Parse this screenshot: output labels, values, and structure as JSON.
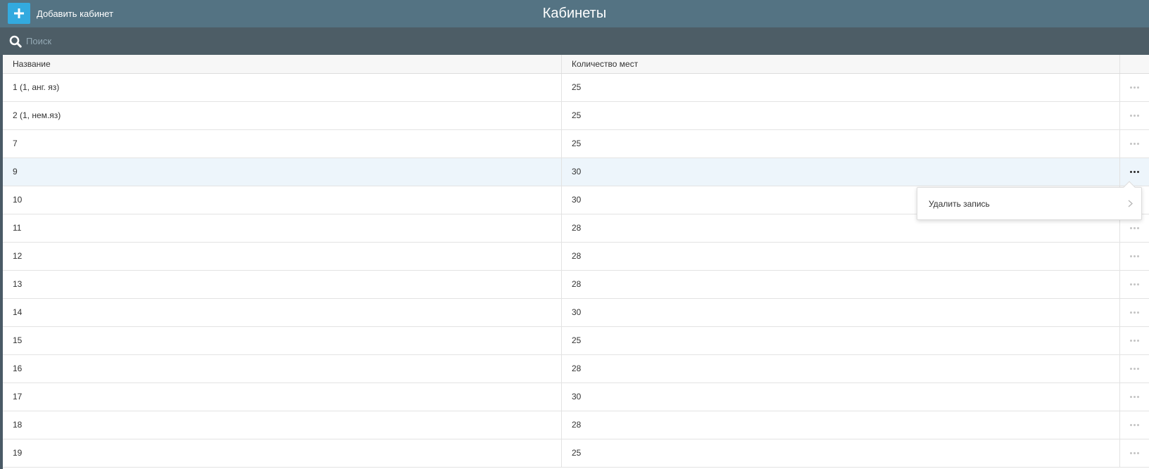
{
  "header": {
    "add_button_label": "Добавить кабинет",
    "title": "Кабинеты",
    "add_icon": "plus-icon"
  },
  "search": {
    "placeholder": "Поиск",
    "value": "",
    "icon": "search-icon"
  },
  "table": {
    "columns": [
      "Название",
      "Количество мест"
    ],
    "rows": [
      {
        "name": "1 (1, анг. яз)",
        "seats": "25"
      },
      {
        "name": "2 (1, нем.яз)",
        "seats": "25"
      },
      {
        "name": "7",
        "seats": "25"
      },
      {
        "name": "9",
        "seats": "30"
      },
      {
        "name": "10",
        "seats": "30"
      },
      {
        "name": "11",
        "seats": "28"
      },
      {
        "name": "12",
        "seats": "28"
      },
      {
        "name": "13",
        "seats": "28"
      },
      {
        "name": "14",
        "seats": "30"
      },
      {
        "name": "15",
        "seats": "25"
      },
      {
        "name": "16",
        "seats": "28"
      },
      {
        "name": "17",
        "seats": "30"
      },
      {
        "name": "18",
        "seats": "28"
      },
      {
        "name": "19",
        "seats": "25"
      }
    ],
    "active_row_index": 3,
    "row_actions_icon": "more-horizontal-icon"
  },
  "context_menu": {
    "items": [
      {
        "label": "Удалить запись"
      }
    ],
    "chevron_icon": "chevron-right-icon"
  },
  "colors": {
    "header_bg": "#547383",
    "search_bg": "#4d5d66",
    "accent": "#33aadf",
    "active_row_bg": "#edf5fb"
  }
}
